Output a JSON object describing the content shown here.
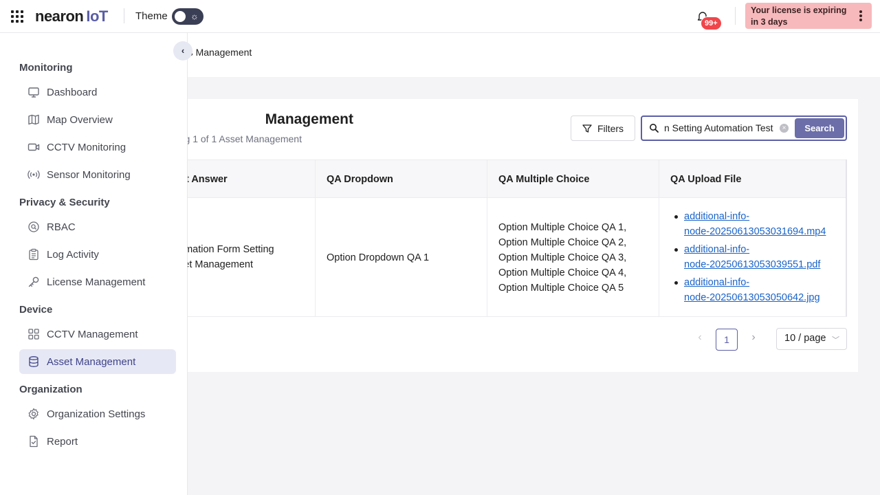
{
  "header": {
    "logo_text": "nearon",
    "logo_suffix": "IoT",
    "theme_label": "Theme",
    "notification_count": "99+",
    "license_notice": "Your license is expiring in 3 days"
  },
  "breadcrumb": {
    "current": "ets Management"
  },
  "sidebar": {
    "sections": [
      {
        "title": "Monitoring",
        "items": [
          {
            "label": "Dashboard",
            "icon": "monitor-icon"
          },
          {
            "label": "Map Overview",
            "icon": "map-icon"
          },
          {
            "label": "CCTV Monitoring",
            "icon": "video-icon"
          },
          {
            "label": "Sensor Monitoring",
            "icon": "broadcast-icon"
          }
        ]
      },
      {
        "title": "Privacy & Security",
        "items": [
          {
            "label": "RBAC",
            "icon": "user-search-icon"
          },
          {
            "label": "Log Activity",
            "icon": "clipboard-icon"
          },
          {
            "label": "License Management",
            "icon": "key-icon"
          }
        ]
      },
      {
        "title": "Device",
        "items": [
          {
            "label": "CCTV Management",
            "icon": "grid-icon"
          },
          {
            "label": "Asset Management",
            "icon": "database-icon",
            "active": true
          }
        ]
      },
      {
        "title": "Organization",
        "items": [
          {
            "label": "Organization Settings",
            "icon": "gear-icon"
          },
          {
            "label": "Report",
            "icon": "file-check-icon"
          }
        ]
      }
    ]
  },
  "page": {
    "title": "Management",
    "subtitle": "g 1 of 1 Asset Management",
    "filters_label": "Filters",
    "search_value": "n Setting Automation Test",
    "search_button": "Search"
  },
  "table": {
    "columns": [
      "t Answer",
      "QA Dropdown",
      "QA Multiple Choice",
      "QA Upload File"
    ],
    "rows": [
      {
        "answer": [
          "omation Form Setting",
          "set Management"
        ],
        "dropdown": "Option Dropdown QA 1",
        "multiple_choice": [
          "Option Multiple Choice QA 1,",
          "Option Multiple Choice QA 2,",
          "Option Multiple Choice QA 3,",
          "Option Multiple Choice QA 4,",
          "Option Multiple Choice QA 5"
        ],
        "files": [
          [
            "additional-info-",
            "node-20250613053031694.mp4"
          ],
          [
            "additional-info-",
            "node-20250613053039551.pdf"
          ],
          [
            "additional-info-",
            "node-20250613053050642.jpg"
          ]
        ]
      }
    ]
  },
  "pagination": {
    "current_page": "1",
    "page_size": "10 / page"
  },
  "colors": {
    "accent": "#5b5ea6",
    "license_bg": "#f7b9bc",
    "badge": "#f0464b",
    "link": "#1a63c8"
  }
}
